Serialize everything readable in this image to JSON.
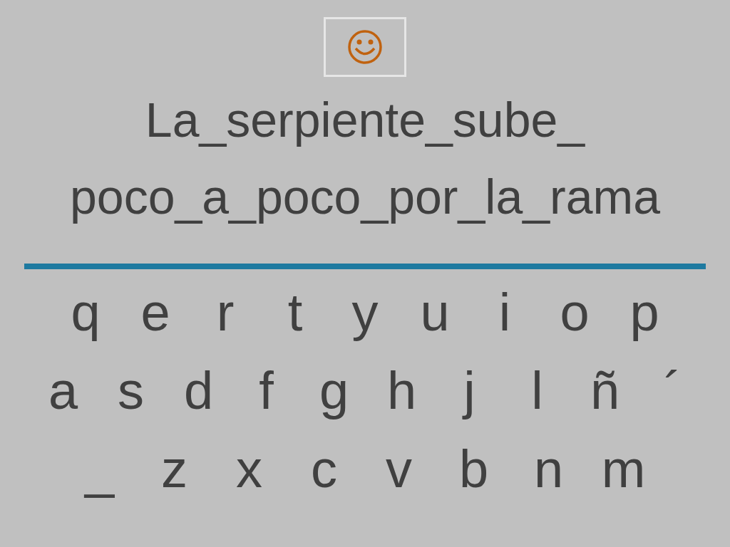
{
  "sentence_lines": [
    "La_serpiente_sube_",
    "poco_a_poco_por_la_rama"
  ],
  "keyboard_rows": [
    [
      "q",
      "e",
      "r",
      "t",
      "y",
      "u",
      "i",
      "o",
      "p"
    ],
    [
      "a",
      "s",
      "d",
      "f",
      "g",
      "h",
      "j",
      "l",
      "ñ",
      "´"
    ],
    [
      "_",
      "z",
      "x",
      "c",
      "v",
      "b",
      "n",
      "m"
    ]
  ]
}
